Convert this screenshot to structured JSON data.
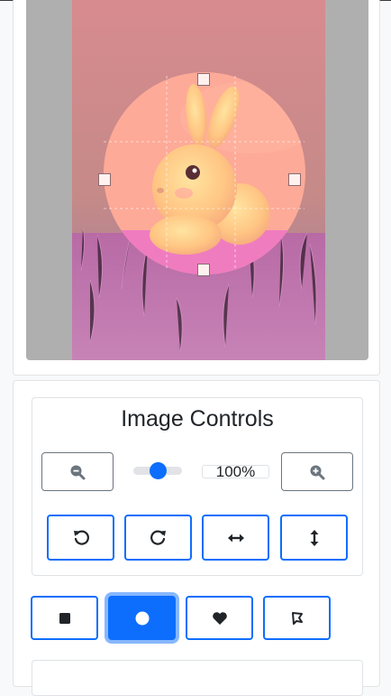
{
  "controls": {
    "title": "Image Controls",
    "zoom_value": "100%",
    "zoom_fraction": 0.5
  },
  "icons": {
    "zoom_out": "zoom-out-icon",
    "zoom_in": "zoom-in-icon",
    "rotate_left": "rotate-left-icon",
    "rotate_right": "rotate-right-icon",
    "flip_horizontal": "flip-horizontal-icon",
    "flip_vertical": "flip-vertical-icon",
    "shape_square": "square-icon",
    "shape_circle": "circle-icon",
    "shape_heart": "heart-icon",
    "shape_custom": "polygon-icon"
  },
  "shapes": {
    "selected": "circle"
  },
  "colors": {
    "accent": "#0d6efd",
    "accent_focus": "#86b7fe",
    "stage": "#afafaf"
  }
}
